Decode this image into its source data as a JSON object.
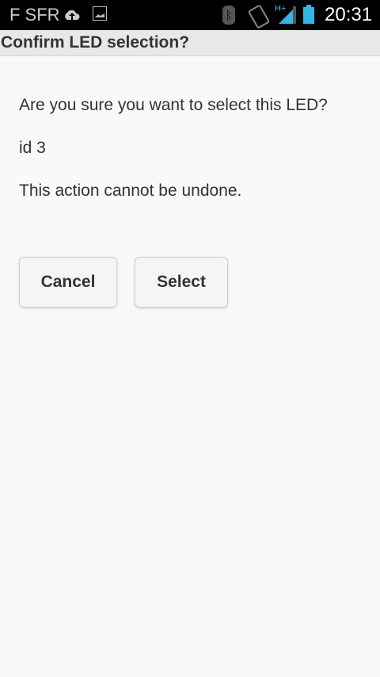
{
  "status_bar": {
    "carrier": "F SFR",
    "time": "20:31",
    "network": "H+",
    "icons": [
      "cloud-upload-icon",
      "image-icon",
      "bluetooth-icon",
      "rotate-icon",
      "signal-icon",
      "battery-icon"
    ],
    "accent": "#33b5e5"
  },
  "dialog": {
    "title": "Confirm LED selection?",
    "message": "Are you sure you want to select this LED?",
    "id_text": "id 3",
    "warning": "This action cannot be undone.",
    "cancel_label": "Cancel",
    "select_label": "Select"
  }
}
